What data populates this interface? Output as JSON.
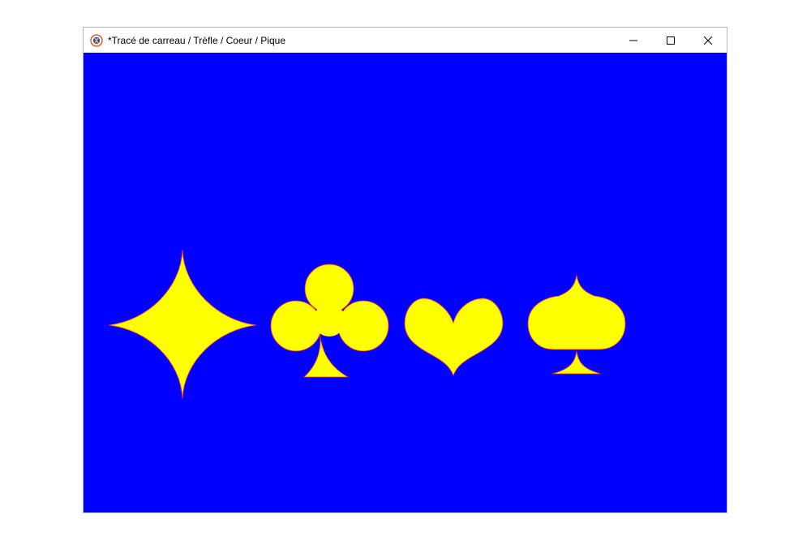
{
  "window": {
    "title": "*Tracé de carreau / Trèfle / Coeur / Pique",
    "app_icon": "python-turtle-icon",
    "controls": {
      "minimize_icon": "minimize-icon",
      "maximize_icon": "maximize-icon",
      "close_icon": "close-icon"
    }
  },
  "canvas": {
    "background_color": "#0000ff",
    "fill_color": "#ffff00",
    "outline_color": "#ff3030",
    "shapes": [
      "diamond",
      "club",
      "heart",
      "spade"
    ]
  }
}
